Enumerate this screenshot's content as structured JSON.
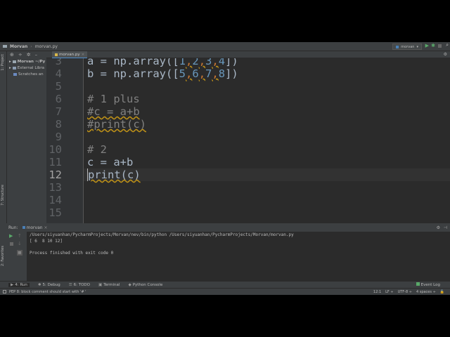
{
  "breadcrumb": {
    "project": "Morvan",
    "file": "morvan.py"
  },
  "toolbar": {
    "run_config": "morvan"
  },
  "side_strip": {
    "project": "1: Project",
    "structure": "7: Structure",
    "favorites": "2: Favorites"
  },
  "project_tree": [
    {
      "label": "Morvan ~/Py"
    },
    {
      "label": "External Libra"
    },
    {
      "label": "Scratches an"
    }
  ],
  "editor_tab": "morvan.py",
  "code_lines": [
    {
      "n": "3",
      "parts": [
        [
          "a = np.array([",
          ""
        ],
        [
          "1",
          "num"
        ],
        [
          ",",
          "com"
        ],
        [
          "2",
          "num"
        ],
        [
          ",",
          "com"
        ],
        [
          "3",
          "num"
        ],
        [
          ",",
          "com"
        ],
        [
          "4",
          "num"
        ],
        [
          "])",
          ""
        ]
      ]
    },
    {
      "n": "4",
      "parts": [
        [
          "b = np.array([",
          ""
        ],
        [
          "5",
          "num"
        ],
        [
          ",",
          "com"
        ],
        [
          "6",
          "num"
        ],
        [
          ",",
          "com"
        ],
        [
          "7",
          "num"
        ],
        [
          ",",
          "com"
        ],
        [
          "8",
          "num"
        ],
        [
          "])",
          ""
        ]
      ]
    },
    {
      "n": "5",
      "parts": []
    },
    {
      "n": "6",
      "parts": [
        [
          "# 1 plus",
          "cm"
        ]
      ]
    },
    {
      "n": "7",
      "parts": [
        [
          "#c = a+b",
          "cm wav"
        ]
      ]
    },
    {
      "n": "8",
      "parts": [
        [
          "#print(c)",
          "cm wav"
        ]
      ]
    },
    {
      "n": "9",
      "parts": []
    },
    {
      "n": "10",
      "parts": [
        [
          "# 2",
          "cm"
        ]
      ]
    },
    {
      "n": "11",
      "parts": [
        [
          "c = a+b",
          ""
        ]
      ]
    },
    {
      "n": "12",
      "parts": [
        [
          "print(c)",
          "wav"
        ]
      ]
    },
    {
      "n": "13",
      "parts": []
    },
    {
      "n": "14",
      "parts": []
    },
    {
      "n": "15",
      "parts": []
    }
  ],
  "current_line": "12",
  "run_panel": {
    "label": "Run:",
    "tab": "morvan",
    "output": "/Users/siyuanhan/PycharmProjects/Morvan/nev/bin/python /Users/siyuanhan/PycharmProjects/Morvan/morvan.py\n[ 6  8 10 12]\n\nProcess finished with exit code 0"
  },
  "tool_tabs": [
    "4: Run",
    "5: Debug",
    "6: TODO",
    "Terminal",
    "Python Console"
  ],
  "event_log": "Event Log",
  "status": {
    "message": "PEP 8: block comment should start with '# '",
    "position": "12:1",
    "line_sep": "LF ÷",
    "encoding": "UTF-8 ÷",
    "indent": "4 spaces ÷"
  }
}
